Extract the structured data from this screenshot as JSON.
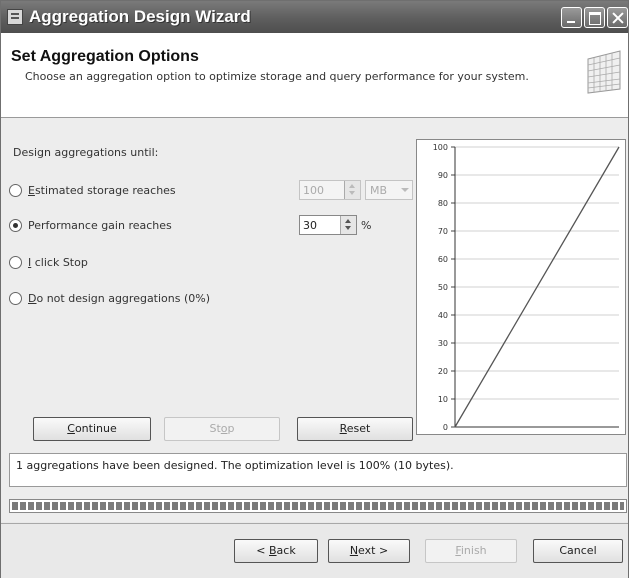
{
  "window": {
    "title": "Aggregation Design Wizard"
  },
  "header": {
    "title": "Set Aggregation Options",
    "description": "Choose an aggregation option to optimize storage and query performance for your system."
  },
  "options": {
    "prompt": "Design aggregations until:",
    "estimated_storage": {
      "label": "Estimated storage reaches",
      "accel": "E",
      "rest": "stimated storage reaches",
      "value": "100",
      "unit": "MB",
      "selected": false,
      "enabled": false
    },
    "performance_gain": {
      "label": "Performance gain reaches",
      "value": "30",
      "unit": "%",
      "selected": true
    },
    "i_click_stop": {
      "label": "I click Stop",
      "accel": "I",
      "rest": " click Stop",
      "selected": false
    },
    "no_aggregations": {
      "label": "Do not design aggregations (0%)",
      "accel": "D",
      "rest": "o not design aggregations (0%)",
      "selected": false
    }
  },
  "action_buttons": {
    "continue": {
      "label": "Continue",
      "accel": "C",
      "rest": "ontinue"
    },
    "stop": {
      "label": "Stop",
      "accel": "o",
      "pre": "St",
      "rest": "p"
    },
    "reset": {
      "label": "Reset",
      "accel": "R",
      "rest": "eset"
    }
  },
  "chart_data": {
    "type": "line",
    "title": "",
    "xlabel": "",
    "ylabel": "",
    "ylim": [
      0,
      100
    ],
    "yticks": [
      "0",
      "10",
      "20",
      "30",
      "40",
      "50",
      "60",
      "70",
      "80",
      "90",
      "100"
    ],
    "x": [
      0,
      1
    ],
    "series": [
      {
        "values": [
          0,
          100
        ]
      }
    ],
    "grid": true
  },
  "status": {
    "message": "1 aggregations have been designed. The optimization level is 100% (10 bytes)."
  },
  "progress": {
    "fraction": 1.0
  },
  "footer": {
    "back": {
      "label": "< Back",
      "pre": "< ",
      "accel": "B",
      "rest": "ack"
    },
    "next": {
      "label": "Next >",
      "accel": "N",
      "rest": "ext >"
    },
    "finish": {
      "label": "Finish",
      "accel": "F",
      "rest": "inish"
    },
    "cancel": {
      "label": "Cancel"
    }
  },
  "colors": {
    "title_bar": "#5e5e5e",
    "header_bg": "#ffffff",
    "content_bg": "#ededed",
    "chart_line": "#555555"
  }
}
